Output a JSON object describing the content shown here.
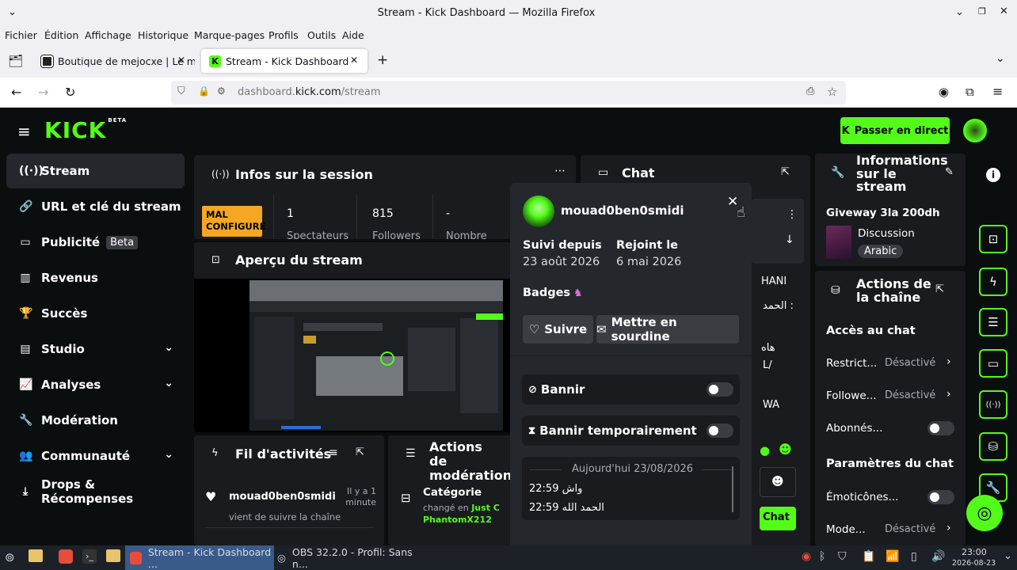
{
  "window": {
    "title": "Stream - Kick Dashboard — Mozilla Firefox"
  },
  "menu": [
    "Fichier",
    "Édition",
    "Affichage",
    "Historique",
    "Marque-pages",
    "Profils",
    "Outils",
    "Aide"
  ],
  "tabs": [
    {
      "label": "Boutique de mejocxe | Le m"
    },
    {
      "label": "Stream - Kick Dashboard"
    }
  ],
  "address": {
    "prefix": "dashboard.",
    "domain": "kick.com",
    "path": "/stream"
  },
  "header": {
    "logo": "KICK",
    "logo_badge": "BETA",
    "go_live": "Passer en direct"
  },
  "sidebar": [
    {
      "label": "Stream",
      "icon": "broadcast-icon"
    },
    {
      "label": "URL et clé du stream",
      "icon": "link-icon"
    },
    {
      "label": "Publicité",
      "badge": "Beta",
      "icon": "ad-icon"
    },
    {
      "label": "Revenus",
      "icon": "revenue-icon"
    },
    {
      "label": "Succès",
      "icon": "trophy-icon"
    },
    {
      "label": "Studio",
      "icon": "studio-icon"
    },
    {
      "label": "Analyses",
      "icon": "analytics-icon"
    },
    {
      "label": "Modération",
      "icon": "wrench-icon"
    },
    {
      "label": "Communauté",
      "icon": "community-icon"
    },
    {
      "label": "Drops & Récompenses",
      "icon": "drops-icon"
    }
  ],
  "session": {
    "title": "Infos sur la session",
    "badge": "MAL CONFIGURÉ",
    "stats": [
      {
        "value": "1",
        "label": "Spectateurs"
      },
      {
        "value": "815",
        "label": "Followers"
      },
      {
        "value": "-",
        "label": "Nombre"
      }
    ]
  },
  "preview": {
    "title": "Aperçu du stream"
  },
  "chat_panel": {
    "title": "Chat",
    "lines": [
      "HANI",
      "الحمد :",
      "هاه",
      "L/",
      "WA"
    ],
    "send_label": "Chat"
  },
  "activity": {
    "title": "Fil d'activités",
    "item": {
      "user": "mouad0ben0smidi",
      "time": "Il y a 1 minute",
      "desc": "vient de suivre la chaîne"
    }
  },
  "mod_actions": {
    "title": "Actions de modération",
    "item": {
      "label": "Catégorie",
      "desc": "changé en",
      "link": "Just C",
      "user": "PhantomX212"
    }
  },
  "stream_info": {
    "title": "Informations sur le stream",
    "stream_title": "Giveway 3la 200dh",
    "category": "Discussion",
    "tag": "Arabic"
  },
  "channel_actions": {
    "title": "Actions de la chaîne",
    "chat_access_title": "Accès au chat",
    "rows": [
      {
        "label": "Restrict...",
        "value": "Désactivé"
      },
      {
        "label": "Followe...",
        "value": "Désactivé"
      }
    ],
    "subscribers_label": "Abonnés...",
    "chat_settings_title": "Paramètres du chat",
    "emotes_label": "Émoticônes...",
    "mode_label": "Mode...",
    "mode_value": "Désactivé"
  },
  "user_card": {
    "username": "mouad0ben0smidi",
    "following_since_label": "Suivi depuis",
    "following_since": "23 août 2026",
    "joined_label": "Rejoint le",
    "joined": "6 mai 2026",
    "badges_label": "Badges",
    "follow_label": "Suivre",
    "mute_label": "Mettre en sourdine",
    "ban_label": "Bannir",
    "timeout_label": "Bannir temporairement",
    "history_date": "Aujourd'hui 23/08/2026",
    "messages": [
      {
        "time": "22:59",
        "text": "واش"
      },
      {
        "time": "22:59",
        "text": "الحمد الله"
      }
    ]
  },
  "taskbar": {
    "window1": "Stream - Kick Dashboard ...",
    "window2": "OBS 32.2.0 - Profil: Sans n...",
    "time": "23:00",
    "date": "2026-08-23"
  },
  "colors": {
    "accent": "#53fc18",
    "warning": "#f5a623",
    "bg": "#0b0e0f",
    "panel": "#191b1f"
  }
}
